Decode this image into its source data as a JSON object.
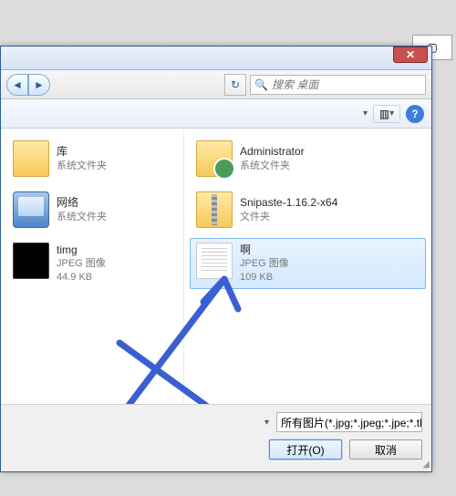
{
  "outer": {
    "square_glyph": "▢"
  },
  "titlebar": {
    "close_glyph": "✕"
  },
  "nav": {
    "back_glyph": "◄",
    "fwd_glyph": "►",
    "refresh_glyph": "↻",
    "search_placeholder": "搜索 桌面"
  },
  "toolbar": {
    "view_glyph": "▥",
    "dropdown_glyph": "▾",
    "help_glyph": "?"
  },
  "left_items": [
    {
      "name": "库",
      "sub": "系统文件夹",
      "icon": "folder"
    },
    {
      "name": "网络",
      "sub": "系统文件夹",
      "icon": "net"
    },
    {
      "name": "timg",
      "sub1": "JPEG 图像",
      "sub2": "44.9 KB",
      "icon": "img-dark"
    }
  ],
  "right_items": [
    {
      "name": "Administrator",
      "sub": "系统文件夹",
      "icon": "folder-user",
      "selected": false
    },
    {
      "name": "Snipaste-1.16.2-x64",
      "sub": "文件夹",
      "icon": "folder-zip",
      "selected": false
    },
    {
      "name": "啊",
      "sub1": "JPEG 图像",
      "sub2": "109 KB",
      "icon": "doc",
      "selected": true
    }
  ],
  "footer": {
    "filter_label": "所有图片(*.jpg;*.jpeg;*.jpe;*.tl",
    "open_label": "打开(O)",
    "cancel_label": "取消"
  },
  "annotation": {
    "color": "#3b5fd1"
  }
}
